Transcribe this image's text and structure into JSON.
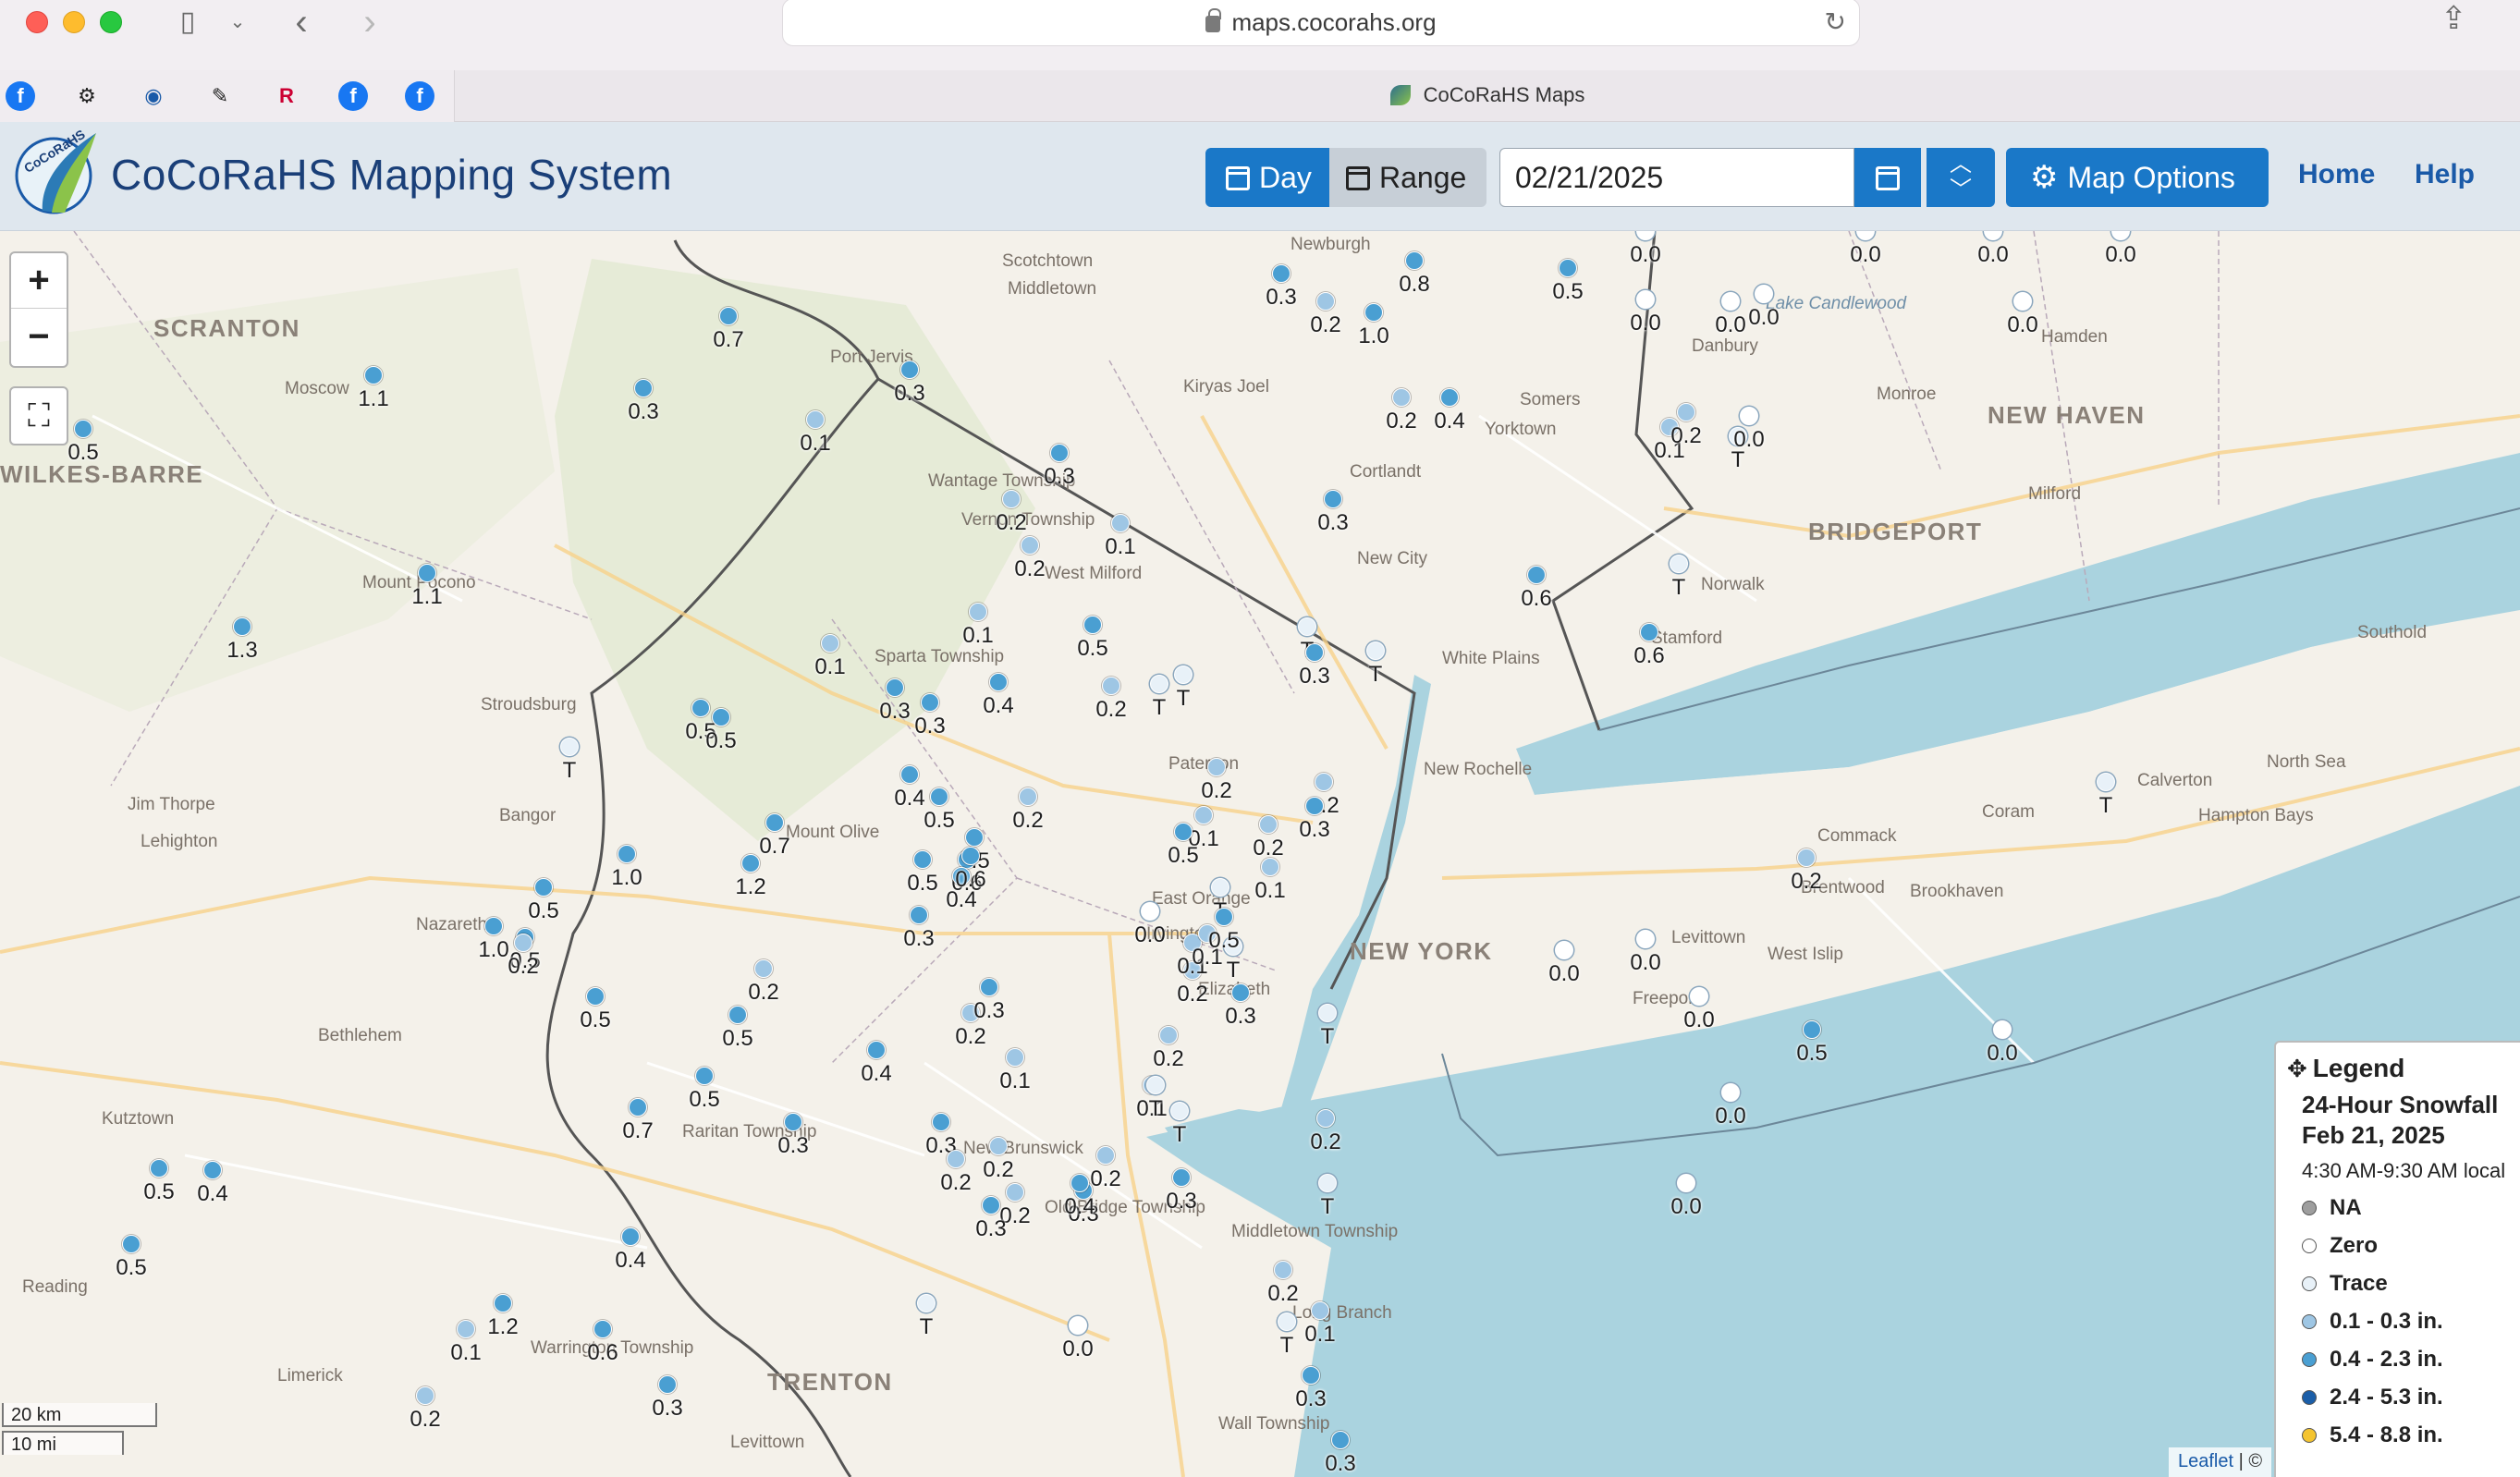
{
  "browser": {
    "url": "maps.cocorahs.org",
    "tab_title": "CoCoRaHS Maps",
    "favorites": [
      {
        "icon": "facebook-icon",
        "glyph": "f",
        "color": "#1877f2"
      },
      {
        "icon": "gear-icon",
        "glyph": "⚙",
        "color": "#222222"
      },
      {
        "icon": "noaa-icon",
        "glyph": "◉",
        "color": "#1a5aa8"
      },
      {
        "icon": "pen-icon",
        "glyph": "✎",
        "color": "#222222"
      },
      {
        "icon": "rutgers-icon",
        "glyph": "R",
        "color": "#cc0033"
      },
      {
        "icon": "facebook-icon",
        "glyph": "f",
        "color": "#1877f2"
      },
      {
        "icon": "facebook-icon",
        "glyph": "f",
        "color": "#1877f2"
      }
    ]
  },
  "header": {
    "title": "CoCoRaHS Mapping System",
    "day_label": "Day",
    "range_label": "Range",
    "date_value": "02/21/2025",
    "map_options_label": "Map Options",
    "nav": [
      "Home",
      "Help"
    ]
  },
  "map": {
    "zoom_in": "+",
    "zoom_out": "−",
    "places": [
      {
        "name": "SCRANTON",
        "big": true
      },
      {
        "name": "WILKES-BARRE",
        "big": true
      },
      {
        "name": "NEW HAVEN",
        "big": true
      },
      {
        "name": "BRIDGEPORT",
        "big": true
      },
      {
        "name": "NEW YORK",
        "big": true
      },
      {
        "name": "TRENTON",
        "big": true
      },
      {
        "name": "Moscow"
      },
      {
        "name": "Mount Pocono"
      },
      {
        "name": "Stroudsburg"
      },
      {
        "name": "Jim Thorpe"
      },
      {
        "name": "Lehighton"
      },
      {
        "name": "Bangor"
      },
      {
        "name": "Nazareth"
      },
      {
        "name": "Bethlehem"
      },
      {
        "name": "Kutztown"
      },
      {
        "name": "Reading"
      },
      {
        "name": "Limerick"
      },
      {
        "name": "Port Jervis"
      },
      {
        "name": "Middletown"
      },
      {
        "name": "Scotchtown"
      },
      {
        "name": "Newburgh"
      },
      {
        "name": "Kiryas Joel"
      },
      {
        "name": "Wantage Township"
      },
      {
        "name": "Vernon Township"
      },
      {
        "name": "West Milford"
      },
      {
        "name": "Sparta Township"
      },
      {
        "name": "Mount Olive"
      },
      {
        "name": "Paterson"
      },
      {
        "name": "East Orange"
      },
      {
        "name": "Irvington"
      },
      {
        "name": "Elizabeth"
      },
      {
        "name": "New Brunswick"
      },
      {
        "name": "Old Bridge Township"
      },
      {
        "name": "Raritan Township"
      },
      {
        "name": "Warrington Township"
      },
      {
        "name": "Levittown"
      },
      {
        "name": "Middletown Township"
      },
      {
        "name": "Long Branch"
      },
      {
        "name": "Wall Township"
      },
      {
        "name": "Cortlandt"
      },
      {
        "name": "New City"
      },
      {
        "name": "White Plains"
      },
      {
        "name": "New Rochelle"
      },
      {
        "name": "Somers"
      },
      {
        "name": "Yorktown"
      },
      {
        "name": "Danbury"
      },
      {
        "name": "Monroe"
      },
      {
        "name": "Hamden"
      },
      {
        "name": "Milford"
      },
      {
        "name": "Norwalk"
      },
      {
        "name": "Stamford"
      },
      {
        "name": "Brentwood"
      },
      {
        "name": "Commack"
      },
      {
        "name": "Levittown"
      },
      {
        "name": "Freeport"
      },
      {
        "name": "West Islip"
      },
      {
        "name": "Brookhaven"
      },
      {
        "name": "Coram"
      },
      {
        "name": "Calverton"
      },
      {
        "name": "Hampton Bays"
      },
      {
        "name": "North Sea"
      },
      {
        "name": "Southold"
      },
      {
        "name": "Lake Candlewood",
        "water": true
      }
    ],
    "stations": [
      {
        "v": "0.5",
        "c": "mid"
      },
      {
        "v": "1.1",
        "c": "mid"
      },
      {
        "v": "0.3",
        "c": "mid"
      },
      {
        "v": "0.7",
        "c": "mid"
      },
      {
        "v": "1.1",
        "c": "mid"
      },
      {
        "v": "1.3",
        "c": "mid"
      },
      {
        "v": "0.3",
        "c": "mid"
      },
      {
        "v": "0.1",
        "c": "low"
      },
      {
        "v": "0.3",
        "c": "mid"
      },
      {
        "v": "0.2",
        "c": "low"
      },
      {
        "v": "0.2",
        "c": "low"
      },
      {
        "v": "0.1",
        "c": "low"
      },
      {
        "v": "0.1",
        "c": "low"
      },
      {
        "v": "0.5",
        "c": "mid"
      },
      {
        "v": "0.1",
        "c": "low"
      },
      {
        "v": "0.3",
        "c": "mid"
      },
      {
        "v": "0.3",
        "c": "mid"
      },
      {
        "v": "0.4",
        "c": "mid"
      },
      {
        "v": "0.2",
        "c": "low"
      },
      {
        "v": "T",
        "c": "trace"
      },
      {
        "v": "T",
        "c": "trace"
      },
      {
        "v": "0.5",
        "c": "mid"
      },
      {
        "v": "0.5",
        "c": "mid"
      },
      {
        "v": "T",
        "c": "trace"
      },
      {
        "v": "0.4",
        "c": "mid"
      },
      {
        "v": "0.5",
        "c": "mid"
      },
      {
        "v": "0.2",
        "c": "low"
      },
      {
        "v": "0.7",
        "c": "mid"
      },
      {
        "v": "1.0",
        "c": "mid"
      },
      {
        "v": "1.2",
        "c": "mid"
      },
      {
        "v": "0.5",
        "c": "mid"
      },
      {
        "v": "0.5",
        "c": "mid"
      },
      {
        "v": "0.6",
        "c": "mid"
      },
      {
        "v": "0.4",
        "c": "mid"
      },
      {
        "v": "0.6",
        "c": "mid"
      },
      {
        "v": "0.5",
        "c": "mid"
      },
      {
        "v": "0.3",
        "c": "mid"
      },
      {
        "v": "0.5",
        "c": "mid"
      },
      {
        "v": "0.2",
        "c": "low"
      },
      {
        "v": "1.0",
        "c": "mid"
      },
      {
        "v": "0.2",
        "c": "low"
      },
      {
        "v": "0.5",
        "c": "mid"
      },
      {
        "v": "0.4",
        "c": "mid"
      },
      {
        "v": "0.7",
        "c": "mid"
      },
      {
        "v": "0.3",
        "c": "mid"
      },
      {
        "v": "0.5",
        "c": "mid"
      },
      {
        "v": "0.4",
        "c": "mid"
      },
      {
        "v": "0.4",
        "c": "mid"
      },
      {
        "v": "0.5",
        "c": "mid"
      },
      {
        "v": "0.5",
        "c": "mid"
      },
      {
        "v": "1.2",
        "c": "mid"
      },
      {
        "v": "0.6",
        "c": "mid"
      },
      {
        "v": "0.1",
        "c": "low"
      },
      {
        "v": "0.2",
        "c": "low"
      },
      {
        "v": "0.3",
        "c": "mid"
      },
      {
        "v": "0.5",
        "c": "mid"
      },
      {
        "v": "0.2",
        "c": "low"
      },
      {
        "v": "0.1",
        "c": "low"
      },
      {
        "v": "0.3",
        "c": "mid"
      },
      {
        "v": "0.2",
        "c": "low"
      },
      {
        "v": "0.2",
        "c": "low"
      },
      {
        "v": "0.2",
        "c": "low"
      },
      {
        "v": "0.3",
        "c": "mid"
      },
      {
        "v": "0.2",
        "c": "low"
      },
      {
        "v": "0.1",
        "c": "low"
      },
      {
        "v": "0.3",
        "c": "mid"
      },
      {
        "v": "0.4",
        "c": "mid"
      },
      {
        "v": "0.2",
        "c": "low"
      },
      {
        "v": "0.3",
        "c": "mid"
      },
      {
        "v": "0.2",
        "c": "low"
      },
      {
        "v": "0.0",
        "c": "zero"
      },
      {
        "v": "0.1",
        "c": "low"
      },
      {
        "v": "0.1",
        "c": "low"
      },
      {
        "v": "T",
        "c": "trace"
      },
      {
        "v": "T",
        "c": "trace"
      },
      {
        "v": "0.3",
        "c": "mid"
      },
      {
        "v": "T",
        "c": "trace"
      },
      {
        "v": "0.3",
        "c": "mid"
      },
      {
        "v": "T",
        "c": "trace"
      },
      {
        "v": "T",
        "c": "trace"
      },
      {
        "v": "0.3",
        "c": "mid"
      },
      {
        "v": "0.3",
        "c": "mid"
      },
      {
        "v": "0.2",
        "c": "low"
      },
      {
        "v": "0.1",
        "c": "low"
      },
      {
        "v": "T",
        "c": "trace"
      },
      {
        "v": "T",
        "c": "trace"
      },
      {
        "v": "0.0",
        "c": "zero"
      },
      {
        "v": "T",
        "c": "trace"
      },
      {
        "v": "0.2",
        "c": "low"
      },
      {
        "v": "0.5",
        "c": "mid"
      },
      {
        "v": "0.3",
        "c": "mid"
      },
      {
        "v": "0.2",
        "c": "low"
      },
      {
        "v": "0.4",
        "c": "mid"
      },
      {
        "v": "1.0",
        "c": "mid"
      },
      {
        "v": "0.8",
        "c": "mid"
      },
      {
        "v": "0.5",
        "c": "mid"
      },
      {
        "v": "0.3",
        "c": "mid"
      },
      {
        "v": "0.2",
        "c": "low"
      },
      {
        "v": "T",
        "c": "trace"
      },
      {
        "v": "T",
        "c": "trace"
      },
      {
        "v": "0.2",
        "c": "low"
      },
      {
        "v": "0.1",
        "c": "low"
      },
      {
        "v": "0.2",
        "c": "low"
      },
      {
        "v": "0.3",
        "c": "mid"
      },
      {
        "v": "0.2",
        "c": "low"
      },
      {
        "v": "0.1",
        "c": "low"
      },
      {
        "v": "0.5",
        "c": "mid"
      },
      {
        "v": "0.3",
        "c": "mid"
      },
      {
        "v": "0.6",
        "c": "mid"
      },
      {
        "v": "0.6",
        "c": "mid"
      },
      {
        "v": "0.1",
        "c": "low"
      },
      {
        "v": "0.2",
        "c": "low"
      },
      {
        "v": "T",
        "c": "trace"
      },
      {
        "v": "T",
        "c": "trace"
      },
      {
        "v": "0.2",
        "c": "low"
      },
      {
        "v": "0.5",
        "c": "mid"
      },
      {
        "v": "0.0",
        "c": "zero"
      },
      {
        "v": "0.0",
        "c": "zero"
      },
      {
        "v": "0.0",
        "c": "zero"
      },
      {
        "v": "0.0",
        "c": "zero"
      },
      {
        "v": "0.0",
        "c": "zero"
      },
      {
        "v": "0.0",
        "c": "zero"
      },
      {
        "v": "T",
        "c": "trace"
      },
      {
        "v": "0.0",
        "c": "zero"
      },
      {
        "v": "0.0",
        "c": "zero"
      },
      {
        "v": "0.0",
        "c": "zero"
      },
      {
        "v": "0.0",
        "c": "zero"
      },
      {
        "v": "0.0",
        "c": "zero"
      },
      {
        "v": "0.0",
        "c": "zero"
      },
      {
        "v": "0.0",
        "c": "zero"
      },
      {
        "v": "0.0",
        "c": "zero"
      },
      {
        "v": "0.0",
        "c": "zero"
      }
    ]
  },
  "legend": {
    "title": "Legend",
    "subtitle": "24-Hour Snowfall",
    "date": "Feb 21, 2025",
    "time_range": "4:30 AM-9:30 AM local",
    "items": [
      {
        "label": "NA",
        "color": "#9e9e9e"
      },
      {
        "label": "Zero",
        "color": "#ffffff"
      },
      {
        "label": "Trace",
        "color": "#e8f1f8"
      },
      {
        "label": "0.1 - 0.3 in.",
        "color": "#9ec6e4"
      },
      {
        "label": "0.4 - 2.3 in.",
        "color": "#4a9fd2"
      },
      {
        "label": "2.4 - 5.3 in.",
        "color": "#1b5ea8"
      },
      {
        "label": "5.4 - 8.8 in.",
        "color": "#f4c430"
      }
    ]
  },
  "scale": {
    "km": "20 km",
    "mi": "10 mi"
  },
  "attribution": {
    "leaflet": "Leaflet",
    "rest": " | ©"
  },
  "colors": {
    "water": "#aad3df",
    "land": "#f4f1ea",
    "forest": "#dfe8cf",
    "zero": "#ffffff",
    "trace": "#e8f1f8",
    "low": "#9ec6e4",
    "mid": "#4a9fd2",
    "accent": "#1a78c8"
  }
}
